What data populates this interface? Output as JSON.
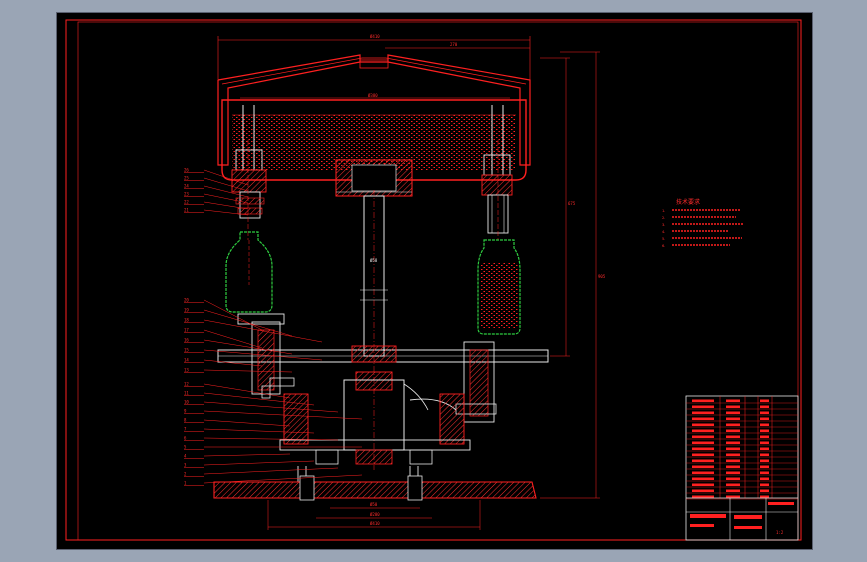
{
  "drawing": {
    "notes_title": "技术要求",
    "notes": [
      "1.",
      "2.",
      "3.",
      "4.",
      "5.",
      "6."
    ],
    "scale": "1:2",
    "dims": {
      "top_width": "Ø410",
      "tank_width": "Ø380",
      "right_span": "270",
      "height_main": "675",
      "height_total": "905",
      "shaft_len": "Ø58",
      "base_width": "Ø450",
      "base_small": "Ø50",
      "base_mid": "Ø280",
      "base_total": "Ø410"
    },
    "callouts": [
      "26",
      "25",
      "24",
      "23",
      "22",
      "21",
      "20",
      "19",
      "18",
      "17",
      "16",
      "15",
      "14",
      "13",
      "12",
      "11",
      "10",
      "9",
      "8",
      "7",
      "6",
      "5",
      "4",
      "3",
      "2",
      "1"
    ]
  },
  "colors": {
    "frame": "#000000",
    "line": "#ff2020",
    "liquid": "#ff2020",
    "bottle": "#2ecc40",
    "white": "#e8e8e8",
    "hatch": "#ff3030"
  }
}
